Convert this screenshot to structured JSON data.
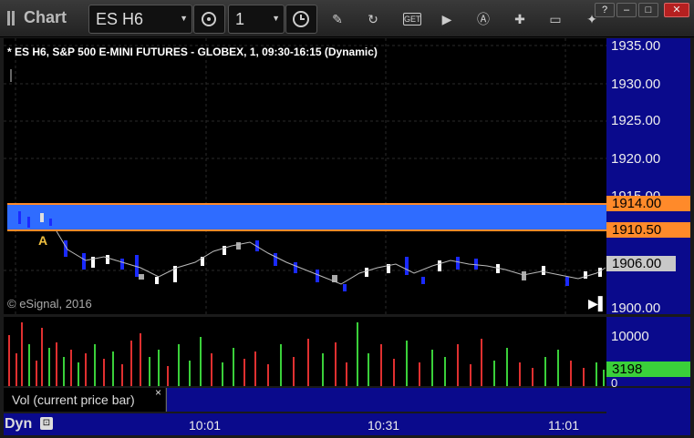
{
  "app": {
    "title": "Chart"
  },
  "toolbar": {
    "symbol": "ES H6",
    "interval": "1",
    "icons": [
      "gear-icon",
      "clock-icon",
      "pencil-icon",
      "refresh-icon",
      "get-icon",
      "play-icon",
      "alert-icon",
      "tools-icon",
      "comment-icon",
      "twitter-icon"
    ],
    "get_label": "GET"
  },
  "window_buttons": [
    "?",
    "–",
    "□",
    "✕"
  ],
  "chart": {
    "title": "* ES H6, S&P 500 E-MINI FUTURES - GLOBEX, 1, 09:30-16:15 (Dynamic)",
    "watermark": "© eSignal, 2016",
    "marker": "A",
    "price_ticks": [
      "1935.00",
      "1930.00",
      "1925.00",
      "1920.00",
      "1915.00",
      "1900.00"
    ],
    "price_tags": {
      "upper": "1914.00",
      "lower": "1910.50",
      "last": "1906.00"
    },
    "band_color": "#2f6cff",
    "line_color": "#ff8a2a"
  },
  "volume": {
    "label": "Vol (current price bar)",
    "close_label": "×",
    "ticks": [
      "10000",
      "0"
    ],
    "current": "3198",
    "up_color": "#3ad03a",
    "down_color": "#e03030"
  },
  "footer": {
    "mode": "Dyn",
    "time_labels": [
      "10:01",
      "10:31",
      "11:01"
    ]
  }
}
